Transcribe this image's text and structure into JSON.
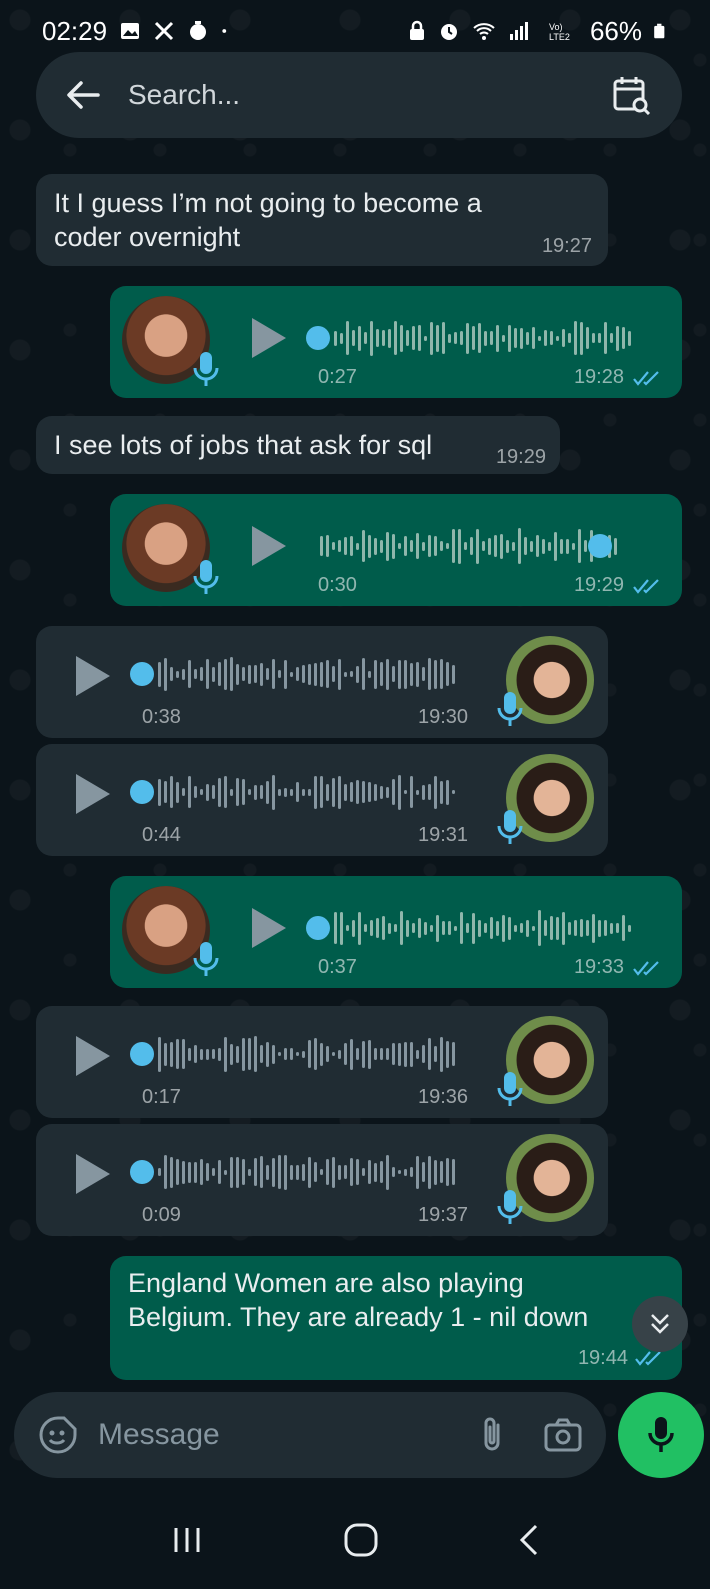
{
  "status_bar": {
    "time": "02:29",
    "battery": "66%"
  },
  "header": {
    "search_placeholder": "Search..."
  },
  "messages": [
    {
      "type": "text",
      "direction": "in",
      "text_line1": "It I guess I’m not going to become a",
      "text_line2": "coder overnight",
      "time": "19:27"
    },
    {
      "type": "voice",
      "direction": "out",
      "duration": "0:27",
      "time": "19:28",
      "progress": 0
    },
    {
      "type": "text",
      "direction": "in",
      "text": "I see lots of jobs that ask for sql",
      "time": "19:29"
    },
    {
      "type": "voice",
      "direction": "out",
      "duration": "0:30",
      "time": "19:29",
      "progress": 0.85
    },
    {
      "type": "voice",
      "direction": "in",
      "duration": "0:38",
      "time": "19:30",
      "progress": 0
    },
    {
      "type": "voice",
      "direction": "in",
      "duration": "0:44",
      "time": "19:31",
      "progress": 0
    },
    {
      "type": "voice",
      "direction": "out",
      "duration": "0:37",
      "time": "19:33",
      "progress": 0
    },
    {
      "type": "voice",
      "direction": "in",
      "duration": "0:17",
      "time": "19:36",
      "progress": 0
    },
    {
      "type": "voice",
      "direction": "in",
      "duration": "0:09",
      "time": "19:37",
      "progress": 0
    },
    {
      "type": "text",
      "direction": "out",
      "text_line1": "England Women are also playing",
      "text_line2": "Belgium. They are already 1 - nil down",
      "time": "19:44"
    }
  ],
  "composer": {
    "placeholder": "Message"
  },
  "colors": {
    "accent": "#21c063",
    "outgoing": "#005c4b",
    "incoming": "#202c33",
    "read_ticks": "#53bdeb"
  },
  "icons": [
    "back-arrow-icon",
    "calendar-search-icon",
    "play-icon",
    "mic-icon",
    "emoji-icon",
    "attach-icon",
    "camera-icon",
    "scroll-down-icon"
  ]
}
